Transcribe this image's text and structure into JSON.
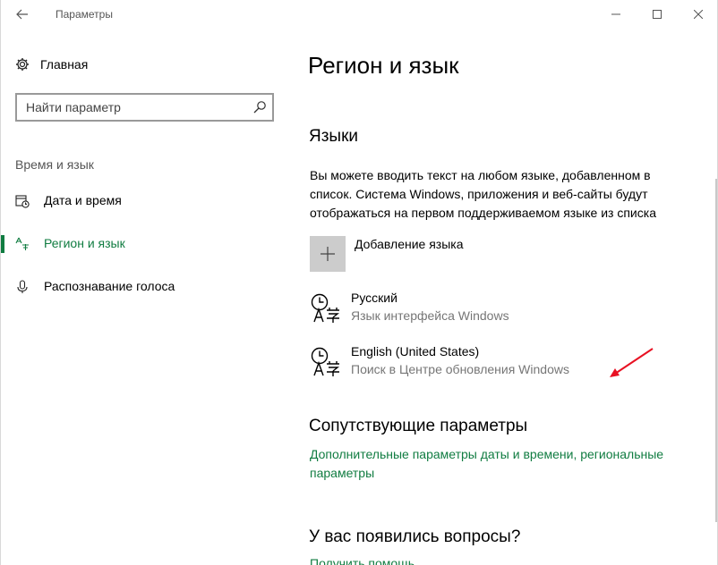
{
  "window": {
    "title": "Параметры"
  },
  "sidebar": {
    "home_label": "Главная",
    "search_placeholder": "Найти параметр",
    "section_header": "Время и язык",
    "items": [
      {
        "label": "Дата и время",
        "icon": "calendar-clock-icon",
        "active": false
      },
      {
        "label": "Регион и язык",
        "icon": "region-language-icon",
        "active": true
      },
      {
        "label": "Распознавание голоса",
        "icon": "microphone-icon",
        "active": false
      }
    ]
  },
  "main": {
    "title": "Регион и язык",
    "languages": {
      "heading": "Языки",
      "description": "Вы можете вводить текст на любом языке, добавленном в список. Система Windows, приложения и веб-сайты будут отображаться на первом поддерживаемом языке из списка",
      "add_label": "Добавление языка",
      "items": [
        {
          "name": "Русский",
          "status": "Язык интерфейса Windows"
        },
        {
          "name": "English (United States)",
          "status": "Поиск в Центре обновления Windows"
        }
      ]
    },
    "related": {
      "heading": "Сопутствующие параметры",
      "link": "Дополнительные параметры даты и времени, региональные параметры"
    },
    "questions": {
      "heading": "У вас появились вопросы?",
      "link": "Получить помощь"
    }
  },
  "colors": {
    "accent": "#107c41",
    "annotation_arrow": "#e81123"
  }
}
